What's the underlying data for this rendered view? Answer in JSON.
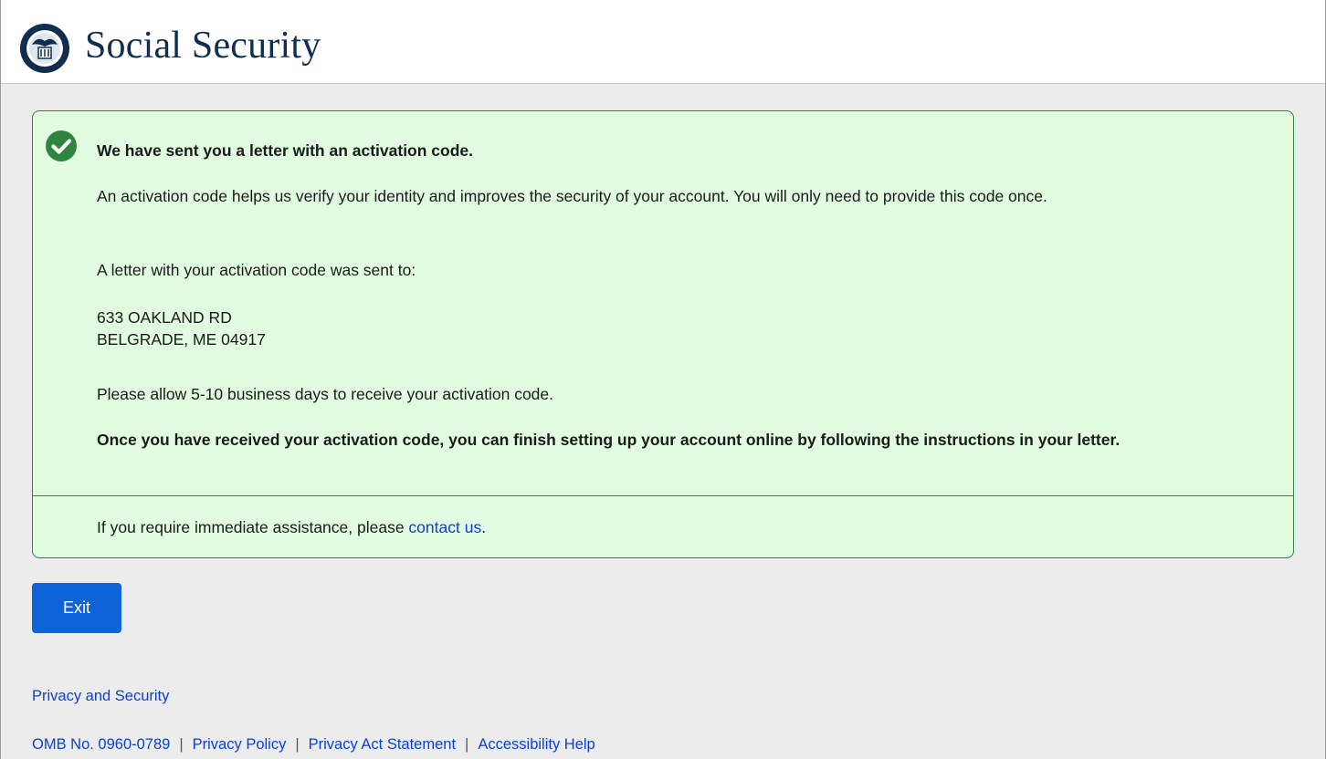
{
  "header": {
    "brand": "Social Security",
    "seal_icon": "ssa-seal-icon"
  },
  "alert": {
    "status_icon": "check-circle-icon",
    "heading": "We have sent you a letter with an activation code.",
    "paragraph1": "An activation code helps us verify your identity and improves the security of your account. You will only need to provide this code once.",
    "paragraph2": "A letter with your activation code was sent to:",
    "address_line1": "633 OAKLAND RD",
    "address_line2": "BELGRADE, ME 04917",
    "paragraph3": "Please allow 5-10 business days to receive your activation code.",
    "paragraph4": "Once you have received your activation code, you can finish setting up your account online by following the instructions in your letter.",
    "assist_prefix": "If you require immediate assistance, please ",
    "assist_link": "contact us",
    "assist_suffix": "."
  },
  "actions": {
    "exit_label": "Exit"
  },
  "footer": {
    "privacy_security": "Privacy and Security",
    "omb": "OMB No. 0960-0789",
    "privacy_policy": "Privacy Policy",
    "privacy_act": "Privacy Act Statement",
    "accessibility": "Accessibility Help",
    "separator": "|"
  },
  "colors": {
    "brand_text": "#112e51",
    "alert_background": "#e0fbdf",
    "alert_border": "#2e8540",
    "button": "#0f63d8",
    "link": "#0b3fd6"
  }
}
